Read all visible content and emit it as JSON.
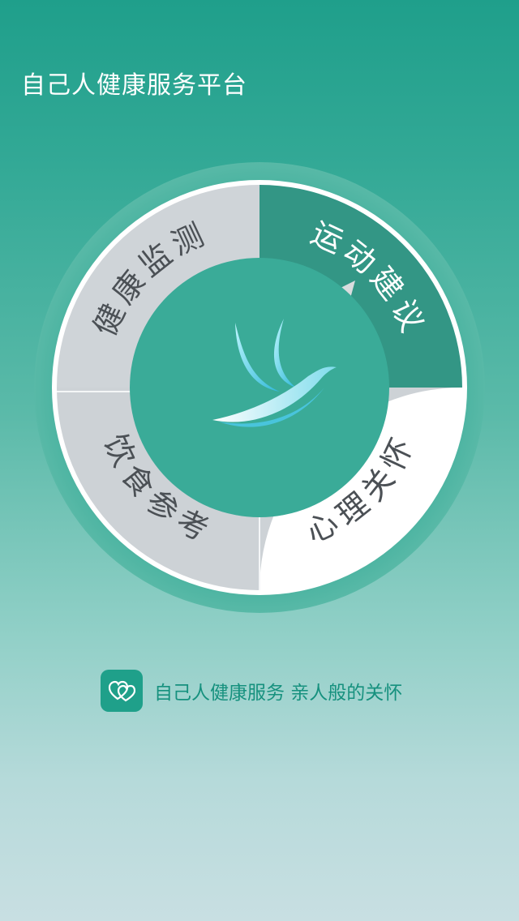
{
  "app": {
    "title": "自己人健康服务平台"
  },
  "wheel": {
    "segments": [
      {
        "label": "健康监测",
        "state": "normal"
      },
      {
        "label": "运动建议",
        "state": "selected"
      },
      {
        "label": "饮食参考",
        "state": "normal"
      },
      {
        "label": "心理关怀",
        "state": "normal"
      }
    ],
    "center_icon": "bird-logo-icon"
  },
  "footer": {
    "logo_icon": "hearts-logo-icon",
    "slogan": "自己人健康服务 亲人般的关怀"
  },
  "colors": {
    "primary": "#2aa38f",
    "selected_segment": "#339685",
    "segment_bg": "#cfd4d8",
    "segment_text": "#4b5055",
    "footer_text": "#16917e"
  }
}
